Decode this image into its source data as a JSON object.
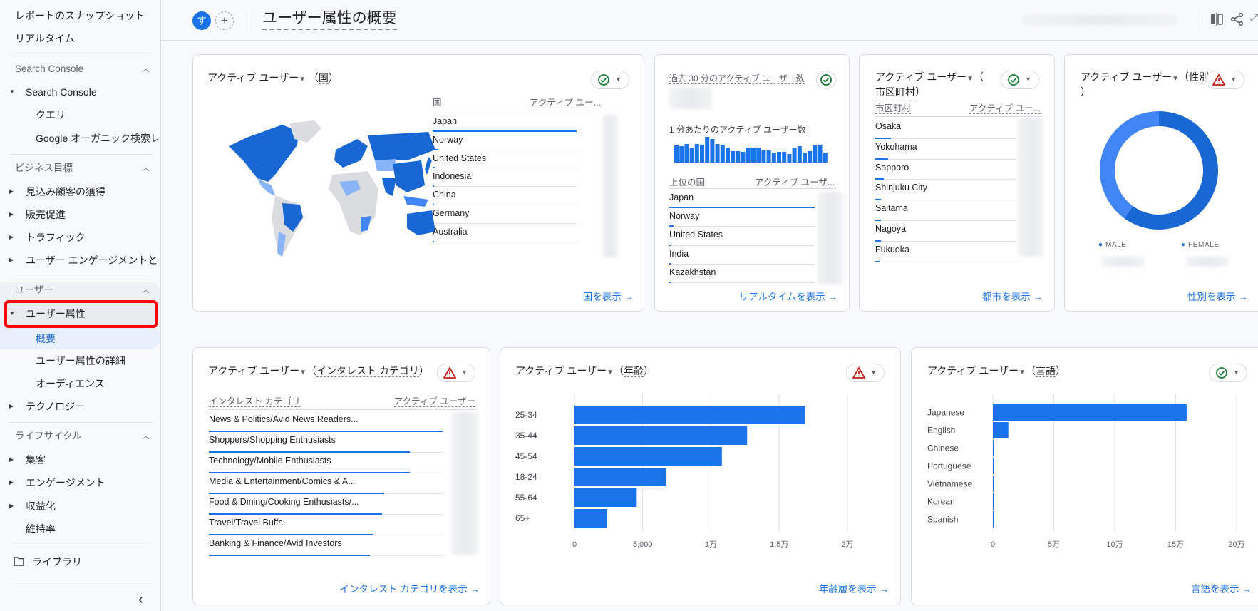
{
  "sidebar": {
    "top_items": [
      "レポートのスナップショット",
      "リアルタイム"
    ],
    "sections": [
      {
        "title": "Search Console",
        "items": [
          {
            "label": "Search Console",
            "expanded": true,
            "children": [
              "クエリ",
              "Google オーガニック検索レ..."
            ]
          }
        ]
      },
      {
        "title": "ビジネス目標",
        "items": [
          {
            "label": "見込み顧客の獲得"
          },
          {
            "label": "販売促進"
          },
          {
            "label": "トラフィック"
          },
          {
            "label": "ユーザー エンゲージメントと..."
          }
        ]
      },
      {
        "title": "ユーザー",
        "items": [
          {
            "label": "ユーザー属性",
            "expanded": true,
            "highlighted": true,
            "children": [
              "概要",
              "ユーザー属性の詳細",
              "オーディエンス"
            ],
            "active_child": "概要"
          },
          {
            "label": "テクノロジー"
          }
        ]
      },
      {
        "title": "ライフサイクル",
        "items": [
          {
            "label": "集客"
          },
          {
            "label": "エンゲージメント"
          },
          {
            "label": "収益化"
          },
          {
            "label": "維持率"
          }
        ]
      }
    ],
    "library_label": "ライブラリ",
    "collapse_icon": "chevron-left-icon"
  },
  "header": {
    "avatar_letter": "す",
    "add_icon": "plus-icon",
    "title": "ユーザー属性の概要",
    "compare_icon": "compare-icon",
    "share_icon": "share-icon"
  },
  "colors": {
    "accent": "#1a73e8",
    "bar": "#1a73e8",
    "dark_blue": "#1967d2",
    "light_blue": "#4285f4",
    "warning": "#e8710a",
    "ok": "#188038"
  },
  "cards": {
    "country": {
      "title": "アクティブ ユーザー",
      "dimension": "国",
      "status": "ok",
      "col_dim": "国",
      "col_metric": "アクティブ ユー...",
      "rows": [
        {
          "label": "Japan",
          "share": 1.0
        },
        {
          "label": "Norway",
          "share": 0.04
        },
        {
          "label": "United States",
          "share": 0.015
        },
        {
          "label": "Indonesia",
          "share": 0.008
        },
        {
          "label": "China",
          "share": 0.007
        },
        {
          "label": "Germany",
          "share": 0.006
        },
        {
          "label": "Australia",
          "share": 0.005
        }
      ],
      "link": "国を表示"
    },
    "realtime": {
      "title": "過去 30 分のアクティブ ユーザー数",
      "status": "ok",
      "per_minute_label": "1 分あたりのアクティブ ユーザー数",
      "per_minute": [
        24,
        23,
        26,
        20,
        26,
        25,
        36,
        33,
        26,
        25,
        21,
        16,
        16,
        15,
        21,
        21,
        21,
        17,
        17,
        14,
        15,
        15,
        12,
        20,
        23,
        14,
        16,
        24,
        25,
        14
      ],
      "col_dim": "上位の国",
      "col_metric": "アクティブ ユーザ...",
      "rows": [
        {
          "label": "Japan",
          "share": 1.0
        },
        {
          "label": "Norway",
          "share": 0.03
        },
        {
          "label": "United States",
          "share": 0.01
        },
        {
          "label": "India",
          "share": 0.008
        },
        {
          "label": "Kazakhstan",
          "share": 0.006
        }
      ],
      "link": "リアルタイムを表示"
    },
    "city": {
      "title": "アクティブ ユーザー",
      "title_paren": "（",
      "dimension": "市区町村",
      "status": "ok",
      "col_dim": "市区町村",
      "col_metric": "アクティブ ユー...",
      "rows": [
        {
          "label": "Osaka",
          "share": 0.11
        },
        {
          "label": "Yokohama",
          "share": 0.09
        },
        {
          "label": "Sapporo",
          "share": 0.06
        },
        {
          "label": "Shinjuku City",
          "share": 0.04
        },
        {
          "label": "Saitama",
          "share": 0.04
        },
        {
          "label": "Nagoya",
          "share": 0.04
        },
        {
          "label": "Fukuoka",
          "share": 0.03
        }
      ],
      "link": "都市を表示"
    },
    "gender": {
      "title": "アクティブ ユーザー",
      "dimension": "性別",
      "status": "warning",
      "legend": [
        "MALE",
        "FEMALE"
      ],
      "link": "性別を表示"
    },
    "interest": {
      "title": "アクティブ ユーザー",
      "dimension": "インタレスト カテゴリ",
      "status": "warning",
      "col_dim": "インタレスト カテゴリ",
      "col_metric": "アクティブ ユーザー",
      "rows": [
        {
          "label": "News & Politics/Avid News Readers...",
          "share": 1.0
        },
        {
          "label": "Shoppers/Shopping Enthusiasts",
          "share": 0.86
        },
        {
          "label": "Technology/Mobile Enthusiasts",
          "share": 0.86
        },
        {
          "label": "Media & Entertainment/Comics & A...",
          "share": 0.75
        },
        {
          "label": "Food & Dining/Cooking Enthusiasts/...",
          "share": 0.74
        },
        {
          "label": "Travel/Travel Buffs",
          "share": 0.7
        },
        {
          "label": "Banking & Finance/Avid Investors",
          "share": 0.69
        }
      ],
      "link": "インタレスト カテゴリを表示"
    },
    "age": {
      "title": "アクティブ ユーザー",
      "dimension": "年齢",
      "status": "warning",
      "link": "年齢層を表示"
    },
    "language": {
      "title": "アクティブ ユーザー",
      "dimension": "言語",
      "status": "ok",
      "link": "言語を表示"
    }
  },
  "chart_data": [
    {
      "type": "pie",
      "title": "アクティブ ユーザー（性別）",
      "categories": [
        "MALE",
        "FEMALE"
      ],
      "values": [
        60,
        40
      ],
      "unit": "percent (estimated)"
    },
    {
      "type": "bar",
      "orientation": "horizontal",
      "title": "アクティブ ユーザー（年齢）",
      "categories": [
        "25-34",
        "35-44",
        "45-54",
        "18-24",
        "55-64",
        "65+"
      ],
      "values": [
        16900,
        12650,
        10800,
        6740,
        4560,
        2390
      ],
      "xlim": [
        0,
        20000
      ],
      "xticks": [
        "0",
        "5,000",
        "1万",
        "1.5万",
        "2万"
      ],
      "grid": true
    },
    {
      "type": "bar",
      "orientation": "horizontal",
      "title": "アクティブ ユーザー（言語）",
      "categories": [
        "Japanese",
        "English",
        "Chinese",
        "Portuguese",
        "Vietnamese",
        "Korean",
        "Spanish"
      ],
      "values": [
        159000,
        12700,
        500,
        400,
        400,
        300,
        300
      ],
      "xlim": [
        0,
        200000
      ],
      "xticks": [
        "0",
        "5万",
        "10万",
        "15万",
        "20万"
      ],
      "grid": true
    },
    {
      "type": "bar",
      "title": "1 分あたりのアクティブ ユーザー数",
      "values": [
        24,
        23,
        26,
        20,
        26,
        25,
        36,
        33,
        26,
        25,
        21,
        16,
        16,
        15,
        21,
        21,
        21,
        17,
        17,
        14,
        15,
        15,
        12,
        20,
        23,
        14,
        16,
        24,
        25,
        14
      ]
    }
  ]
}
